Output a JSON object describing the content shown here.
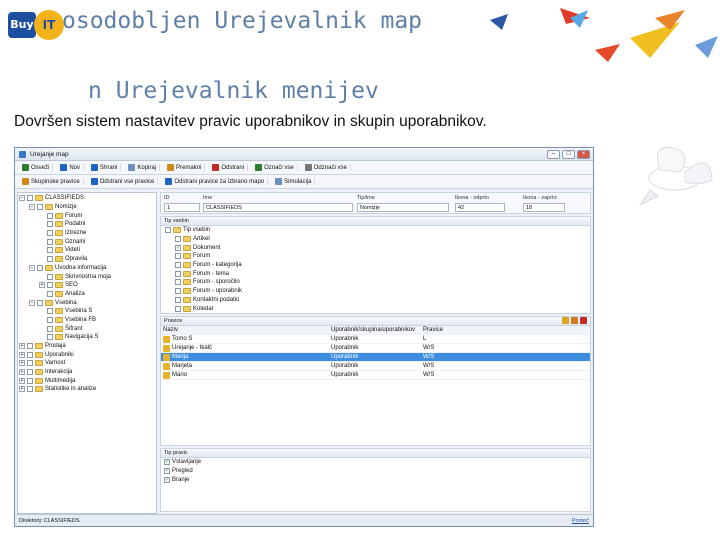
{
  "slide": {
    "title_line1": "osodobljen Urejevalnik map",
    "title_line2": "n Urejevalnik menijev",
    "subtitle": "Dovršen sistem nastavitev pravic uporabnikov in skupin uporabnikov."
  },
  "logo": {
    "left_text": "Buy",
    "right_text": "IT"
  },
  "window": {
    "title": "Urejanje map",
    "toolbar1": [
      {
        "label": "Osveži",
        "icon": "refresh-icon",
        "color": "#2e7d32"
      },
      {
        "label": "Nov",
        "icon": "new-icon",
        "color": "#1e63c4"
      },
      {
        "label": "Shrani",
        "icon": "save-icon",
        "color": "#1e63c4"
      },
      {
        "label": "Kopiraj",
        "icon": "copy-icon",
        "color": "#6b8fbf"
      },
      {
        "label": "Premakni",
        "icon": "move-icon",
        "color": "#d08a1a"
      },
      {
        "label": "Odstrani",
        "icon": "delete-icon",
        "color": "#c62828"
      },
      {
        "label": "Označi vse",
        "icon": "check-all-icon",
        "color": "#2e7d32"
      },
      {
        "label": "Odznači vse",
        "icon": "uncheck-all-icon",
        "color": "#777777"
      }
    ],
    "toolbar2": [
      {
        "label": "Skupinske pravice",
        "icon": "group-rights-icon",
        "color": "#d08a1a"
      },
      {
        "label": "Odstrani vse pravice",
        "icon": "remove-rights-icon",
        "color": "#1e63c4"
      },
      {
        "label": "Odstrani pravice za izbrano mapo",
        "icon": "remove-folder-rights-icon",
        "color": "#1e63c4"
      },
      {
        "label": "Simulacija",
        "icon": "simulation-icon",
        "color": "#6b8fbf"
      }
    ],
    "tree": [
      {
        "label": "CLASSIFIEDS",
        "depth": 0,
        "exp": "−",
        "checked": false
      },
      {
        "label": "Nomizje",
        "depth": 1,
        "exp": "−",
        "checked": false
      },
      {
        "label": "Forum",
        "depth": 2,
        "exp": "",
        "checked": false
      },
      {
        "label": "Podatni",
        "depth": 2,
        "exp": "",
        "checked": false
      },
      {
        "label": "Iztrezne",
        "depth": 2,
        "exp": "",
        "checked": false
      },
      {
        "label": "Oznalni",
        "depth": 2,
        "exp": "",
        "checked": false
      },
      {
        "label": "Videti",
        "depth": 2,
        "exp": "",
        "checked": false
      },
      {
        "label": "Opravila",
        "depth": 2,
        "exp": "",
        "checked": false
      },
      {
        "label": "Uvodna informacija",
        "depth": 1,
        "exp": "−",
        "checked": false
      },
      {
        "label": "Skrivnostna moja",
        "depth": 2,
        "exp": "",
        "checked": false
      },
      {
        "label": "SEO",
        "depth": 2,
        "exp": "+",
        "checked": false
      },
      {
        "label": "Analiza",
        "depth": 2,
        "exp": "",
        "checked": false
      },
      {
        "label": "Vsebina",
        "depth": 1,
        "exp": "−",
        "checked": false
      },
      {
        "label": "Vsebina S",
        "depth": 2,
        "exp": "",
        "checked": false
      },
      {
        "label": "Vsebina FB",
        "depth": 2,
        "exp": "",
        "checked": false
      },
      {
        "label": "Šifrant",
        "depth": 2,
        "exp": "",
        "checked": false
      },
      {
        "label": "Navigacija S",
        "depth": 2,
        "exp": "",
        "checked": false
      },
      {
        "label": "Prodaja",
        "depth": 0,
        "exp": "+",
        "checked": false
      },
      {
        "label": "Uporabniki",
        "depth": 0,
        "exp": "+",
        "checked": false
      },
      {
        "label": "Varnost",
        "depth": 0,
        "exp": "+",
        "checked": false
      },
      {
        "label": "Interakcija",
        "depth": 0,
        "exp": "+",
        "checked": false
      },
      {
        "label": "Multimedija",
        "depth": 0,
        "exp": "+",
        "checked": false
      },
      {
        "label": "Statistike in analize",
        "depth": 0,
        "exp": "+",
        "checked": false
      }
    ],
    "form": {
      "id_label": "ID",
      "id_value": "1",
      "name_label": "Ime",
      "name_value": "CLASSIFIEDS",
      "type_label": "Tip/ime",
      "type_value": "Nomizje",
      "open_label": "Ikona - odprto",
      "open_value": "42",
      "closed_label": "Ikona - zaprto",
      "closed_value": "18"
    },
    "types_header": "Tip vsebin",
    "types": [
      {
        "label": "Tip vsebin",
        "depth": 0,
        "checked": false
      },
      {
        "label": "Artikel",
        "depth": 1,
        "checked": false
      },
      {
        "label": "Dokument",
        "depth": 1,
        "checked": true
      },
      {
        "label": "Forum",
        "depth": 1,
        "checked": false
      },
      {
        "label": "Forum - kategorija",
        "depth": 1,
        "checked": false
      },
      {
        "label": "Forum - tema",
        "depth": 1,
        "checked": false
      },
      {
        "label": "Forum - sporočilo",
        "depth": 1,
        "checked": false
      },
      {
        "label": "Forum - uporabnik",
        "depth": 1,
        "checked": false
      },
      {
        "label": "Kontaktni podatki",
        "depth": 1,
        "checked": false
      },
      {
        "label": "Koledar",
        "depth": 1,
        "checked": false
      }
    ],
    "rights_header": "Pravice",
    "rights_columns": [
      "Naziv",
      "Uporabnik/skupina/uporabnikov",
      "Pravice"
    ],
    "rights_rows": [
      {
        "name": "Tomo S",
        "kind": "Uporabnik",
        "rights": "L",
        "selected": false
      },
      {
        "name": "Urejanje - tkalč",
        "kind": "Uporabnik",
        "rights": "W/S",
        "selected": false
      },
      {
        "name": "Marija",
        "kind": "Uporabnik",
        "rights": "W/S",
        "selected": true
      },
      {
        "name": "Marjeta",
        "kind": "Uporabnik",
        "rights": "W/S",
        "selected": false
      },
      {
        "name": "Mario",
        "kind": "Uporabnik",
        "rights": "W/S",
        "selected": false
      }
    ],
    "ptype_header": "Tip pravic",
    "ptypes": [
      {
        "label": "Vstavljanje",
        "checked": true
      },
      {
        "label": "Pregled",
        "checked": true
      },
      {
        "label": "Branje",
        "checked": true
      }
    ],
    "status_text": "Direktorij: CLASSIFIEDS",
    "help_label": "Pomoč"
  }
}
